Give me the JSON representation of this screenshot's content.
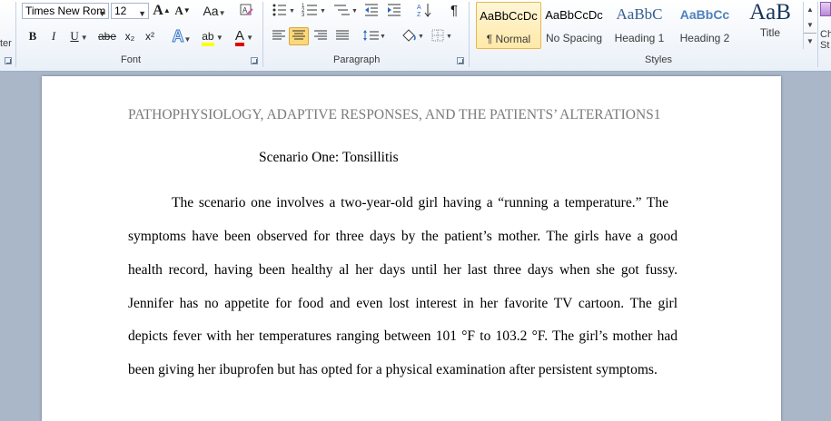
{
  "ribbon": {
    "clipboard_partial_label": "ter",
    "font": {
      "group_label": "Font",
      "font_name": "Times New Rom",
      "font_size": "12",
      "grow_icon": "A",
      "shrink_icon": "A",
      "change_case_label": "Aa",
      "bold": "B",
      "italic": "I",
      "underline": "U",
      "strikethrough": "abe",
      "subscript": "x₂",
      "superscript": "x²",
      "text_effects": "A",
      "highlight": "ab",
      "font_color": "A"
    },
    "paragraph": {
      "group_label": "Paragraph",
      "show_marks": "¶"
    },
    "styles": {
      "group_label": "Styles",
      "items": [
        {
          "sample": "AaBbCcDc",
          "name": "¶ Normal"
        },
        {
          "sample": "AaBbCcDc",
          "name": "No Spacing"
        },
        {
          "sample": "AaBbC",
          "name": "Heading 1"
        },
        {
          "sample": "AaBbCc",
          "name": "Heading 2"
        },
        {
          "sample": "AaB",
          "name": "Title"
        }
      ],
      "change_styles_partial": [
        "Ch",
        "St"
      ]
    },
    "colors": {
      "highlight": "#ffff00",
      "font_color": "#e00000",
      "heading": "#365f91",
      "title": "#17365d"
    }
  },
  "document": {
    "header": "PATHOPHYSIOLOGY, ADAPTIVE RESPONSES, AND THE PATIENTS’ ALTERATIONS1",
    "title": "Scenario One: Tonsillitis",
    "lines": [
      "The scenario one involves a two-year-old girl having a “running a temperature.”  The",
      "symptoms have been observed for three days by the patient’s mother. The girls have a good",
      "health record, having been healthy al her days until her last three days when she got fussy.",
      "Jennifer has no appetite for food and even lost interest in her favorite TV cartoon. The girl",
      "depicts fever with her temperatures ranging between 101 °F to 103.2 °F. The girl’s mother had",
      "been giving her ibuprofen but has opted for a physical examination after persistent symptoms."
    ]
  }
}
